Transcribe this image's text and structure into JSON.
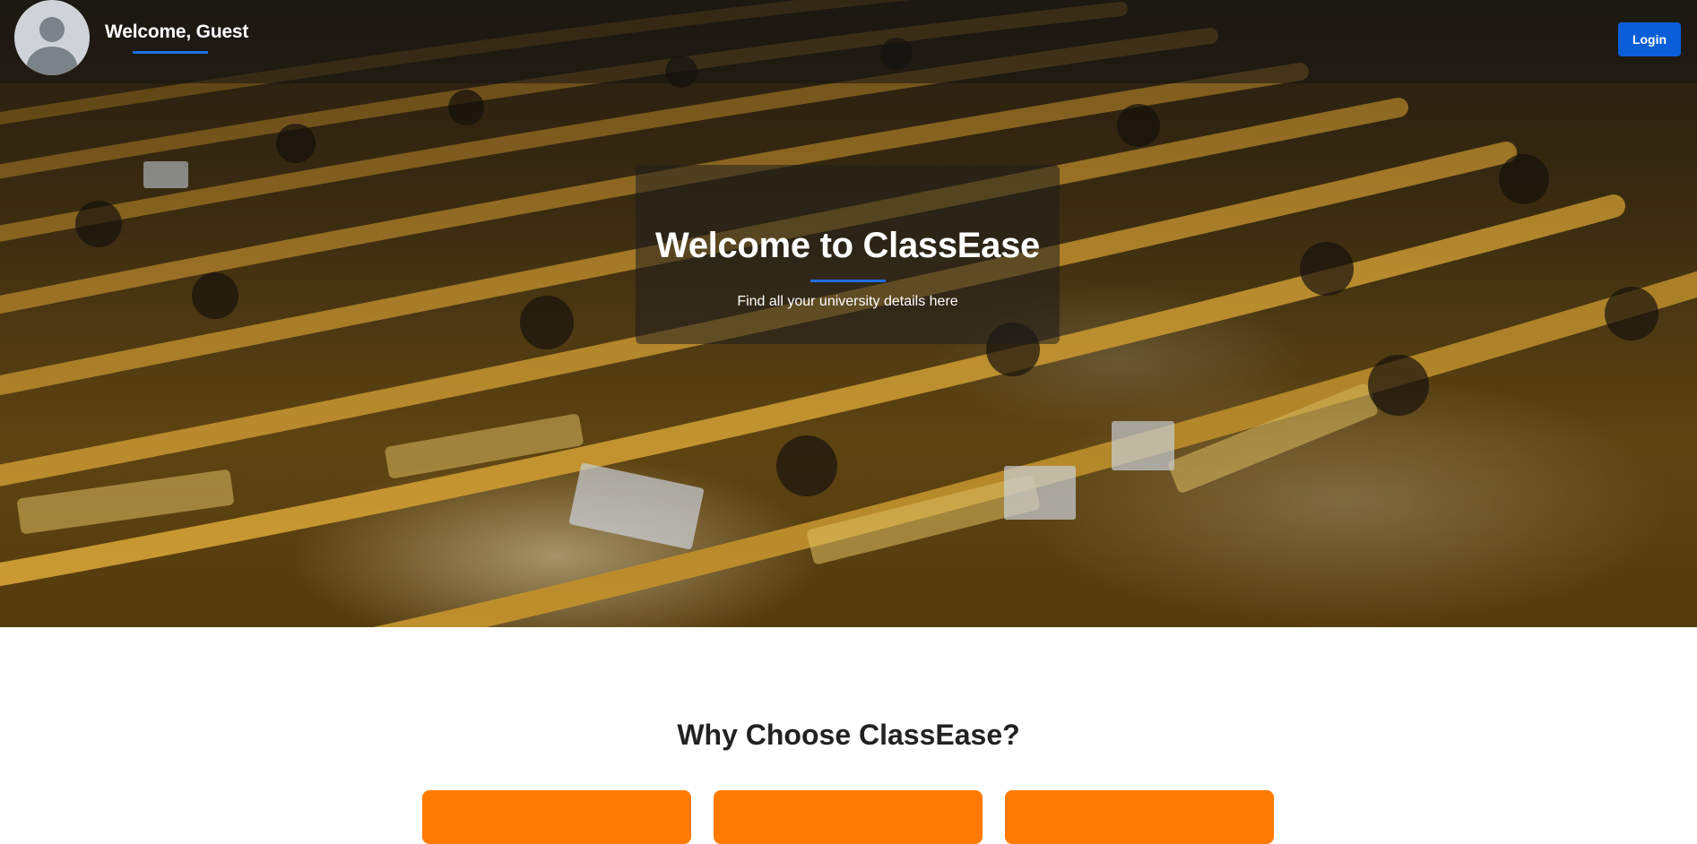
{
  "header": {
    "greeting": "Welcome, Guest",
    "login_label": "Login",
    "avatar_icon": "user-avatar-icon"
  },
  "hero": {
    "title": "Welcome to ClassEase",
    "subtitle": "Find all your university details here",
    "background": "lecture-hall-photo"
  },
  "why_section": {
    "title": "Why Choose ClassEase?",
    "cards": [
      {
        "color": "#ff7a00"
      },
      {
        "color": "#ff7a00"
      },
      {
        "color": "#ff7a00"
      }
    ]
  },
  "colors": {
    "accent": "#1f6fe0",
    "button": "#0b5ed7",
    "card": "#ff7a00"
  }
}
